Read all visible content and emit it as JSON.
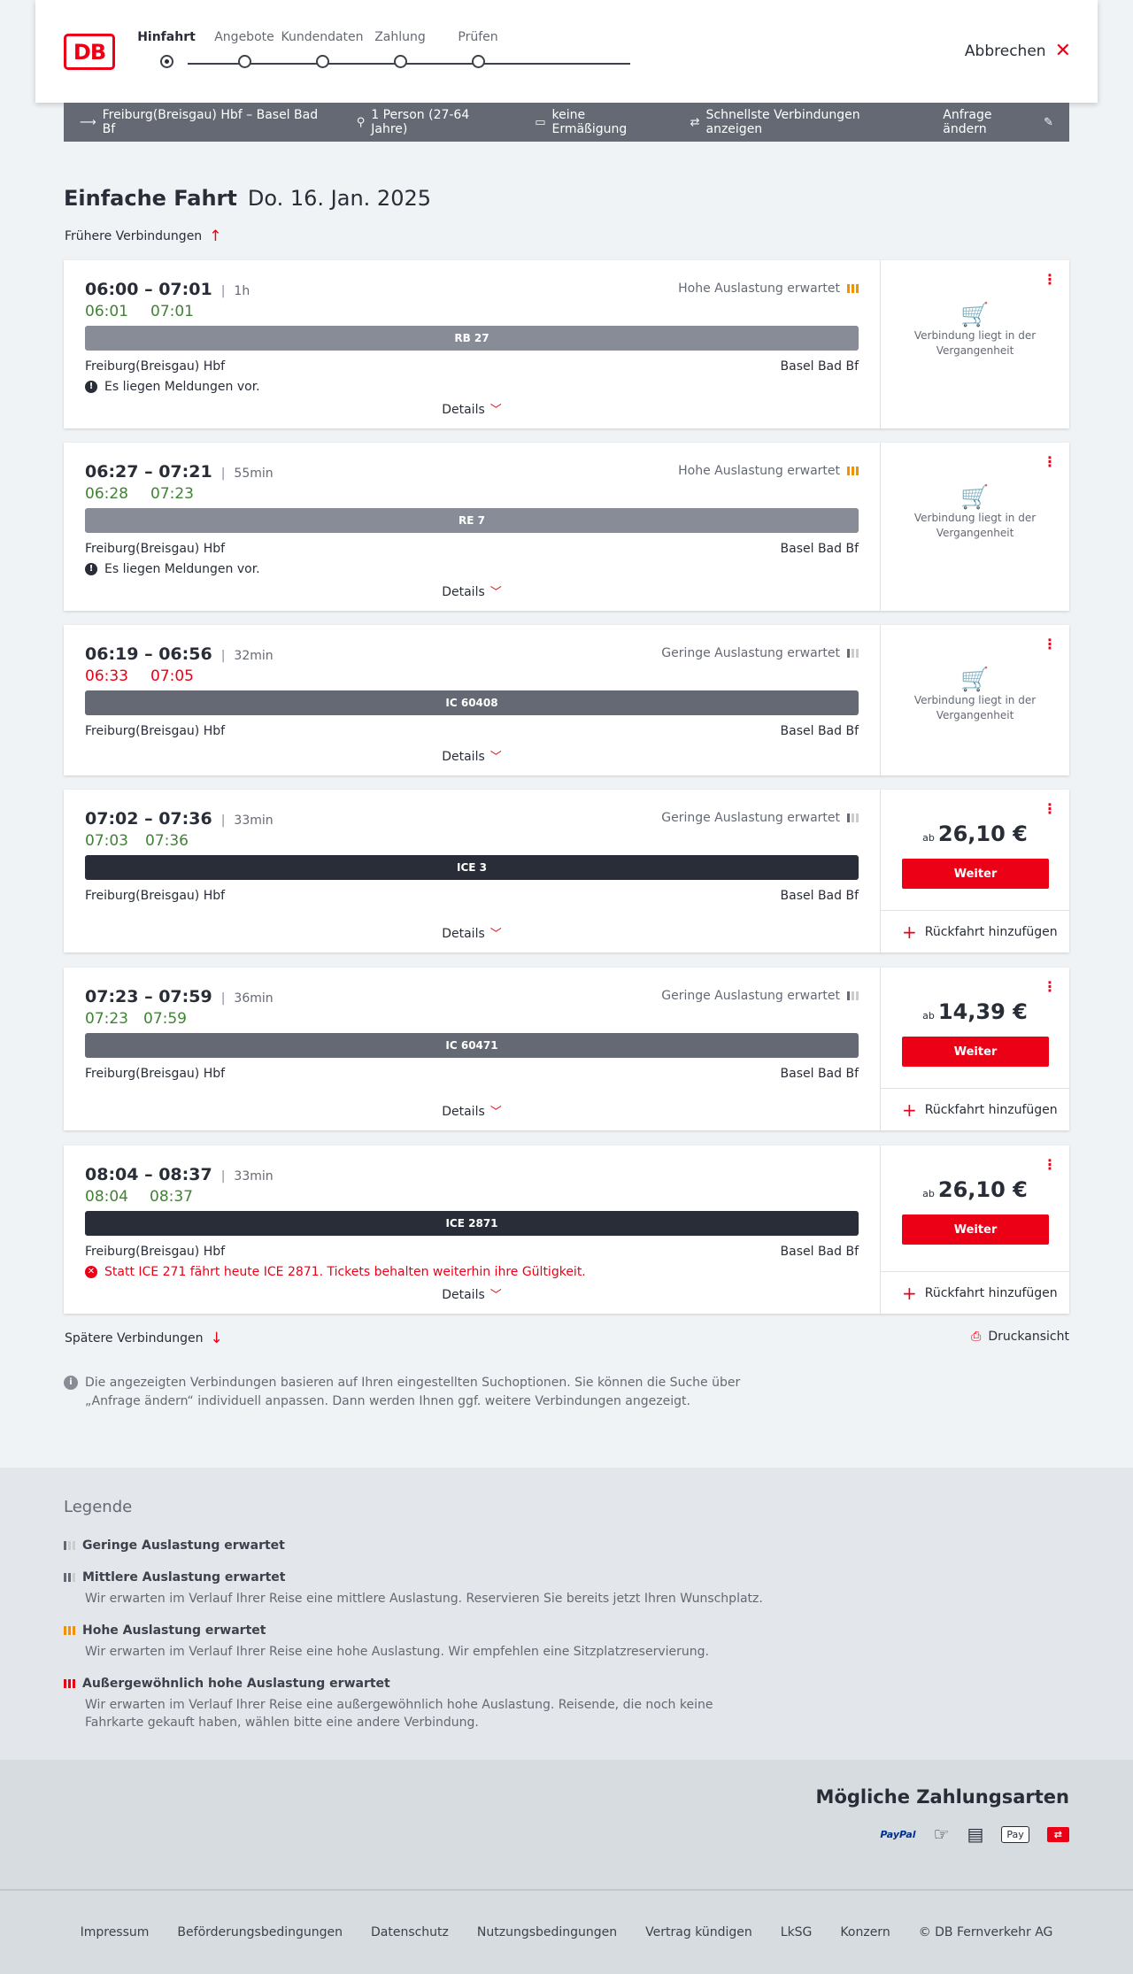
{
  "header": {
    "logo": "DB",
    "steps": [
      "Hinfahrt",
      "Angebote",
      "Kundendaten",
      "Zahlung",
      "Prüfen"
    ],
    "cancel": "Abbrechen"
  },
  "summary": {
    "route": "Freiburg(Breisgau) Hbf – Basel Bad Bf",
    "persons": "1 Person (27-64 Jahre)",
    "discount": "keine Ermäßigung",
    "fastest": "Schnellste Verbindungen anzeigen",
    "change": "Anfrage ändern"
  },
  "page": {
    "title": "Einfache Fahrt",
    "date": "Do. 16. Jan. 2025",
    "earlier": "Frühere Verbindungen",
    "later": "Spätere Verbindungen",
    "print": "Druckansicht",
    "info": "Die angezeigten Verbindungen basieren auf Ihren eingestellten Suchoptionen. Sie können die Suche über „Anfrage ändern“ individuell anpassen. Dann werden Ihnen ggf. weitere Verbindungen angezeigt."
  },
  "labels": {
    "details": "Details",
    "past": "Verbindung liegt in der Vergangenheit",
    "weiter": "Weiter",
    "return": "Rückfahrt hinzufügen",
    "ab": "ab"
  },
  "connections": [
    {
      "times": "06:00 – 07:01",
      "duration": "1h",
      "rt_dep": "06:01",
      "rt_arr": "07:01",
      "rt_color": "green",
      "load": "Hohe Auslastung erwartet",
      "train": "RB 27",
      "from": "Freiburg(Breisgau) Hbf",
      "to": "Basel Bad Bf",
      "message": "Es liegen Meldungen vor."
    },
    {
      "times": "06:27 – 07:21",
      "duration": "55min",
      "rt_dep": "06:28",
      "rt_arr": "07:23",
      "rt_color": "green",
      "load": "Hohe Auslastung erwartet",
      "train": "RE 7",
      "from": "Freiburg(Breisgau) Hbf",
      "to": "Basel Bad Bf",
      "message": "Es liegen Meldungen vor."
    },
    {
      "times": "06:19 – 06:56",
      "duration": "32min",
      "rt_dep": "06:33",
      "rt_arr": "07:05",
      "rt_color": "red",
      "load": "Geringe Auslastung erwartet",
      "train": "IC 60408",
      "from": "Freiburg(Breisgau) Hbf",
      "to": "Basel Bad Bf"
    },
    {
      "times": "07:02 – 07:36",
      "duration": "33min",
      "rt_dep": "07:03",
      "rt_arr": "07:36",
      "rt_color": "green",
      "load": "Geringe Auslastung erwartet",
      "train": "ICE 3",
      "from": "Freiburg(Breisgau) Hbf",
      "to": "Basel Bad Bf",
      "price": "26,10 €"
    },
    {
      "times": "07:23 – 07:59",
      "duration": "36min",
      "rt_dep": "07:23",
      "rt_arr": "07:59",
      "rt_color": "green",
      "load": "Geringe Auslastung erwartet",
      "train": "IC 60471",
      "from": "Freiburg(Breisgau) Hbf",
      "to": "Basel Bad Bf",
      "price": "14,39 €"
    },
    {
      "times": "08:04 – 08:37",
      "duration": "33min",
      "rt_dep": "08:04",
      "rt_arr": "08:37",
      "rt_color": "green",
      "train": "ICE 2871",
      "from": "Freiburg(Breisgau) Hbf",
      "to": "Basel Bad Bf",
      "error": "Statt ICE 271 fährt heute ICE 2871. Tickets behalten weiterhin ihre Gültigkeit.",
      "price": "26,10 €"
    }
  ],
  "legend": {
    "title": "Legende",
    "items": [
      {
        "title": "Geringe Auslastung erwartet",
        "text": ""
      },
      {
        "title": "Mittlere Auslastung erwartet",
        "text": "Wir erwarten im Verlauf Ihrer Reise eine mittlere Auslastung. Reservieren Sie bereits jetzt Ihren Wunschplatz."
      },
      {
        "title": "Hohe Auslastung erwartet",
        "text": "Wir erwarten im Verlauf Ihrer Reise eine hohe Auslastung. Wir empfehlen eine Sitzplatzreservierung."
      },
      {
        "title": "Außergewöhnlich hohe Auslastung erwartet",
        "text": "Wir erwarten im Verlauf Ihrer Reise eine außergewöhnlich hohe Auslastung. Reisende, die noch keine Fahrkarte gekauft haben, wählen bitte eine andere Verbindung."
      }
    ]
  },
  "payment": {
    "title": "Mögliche Zahlungsarten",
    "paypal": "PayPal",
    "applepay": "Pay"
  },
  "footer": [
    "Impressum",
    "Beförderungsbedingungen",
    "Datenschutz",
    "Nutzungsbedingungen",
    "Vertrag kündigen",
    "LkSG",
    "Konzern",
    "© DB Fernverkehr AG"
  ],
  "colors": {
    "accent": "#ec0016",
    "on_time": "#408335",
    "dark": "#282d37"
  }
}
